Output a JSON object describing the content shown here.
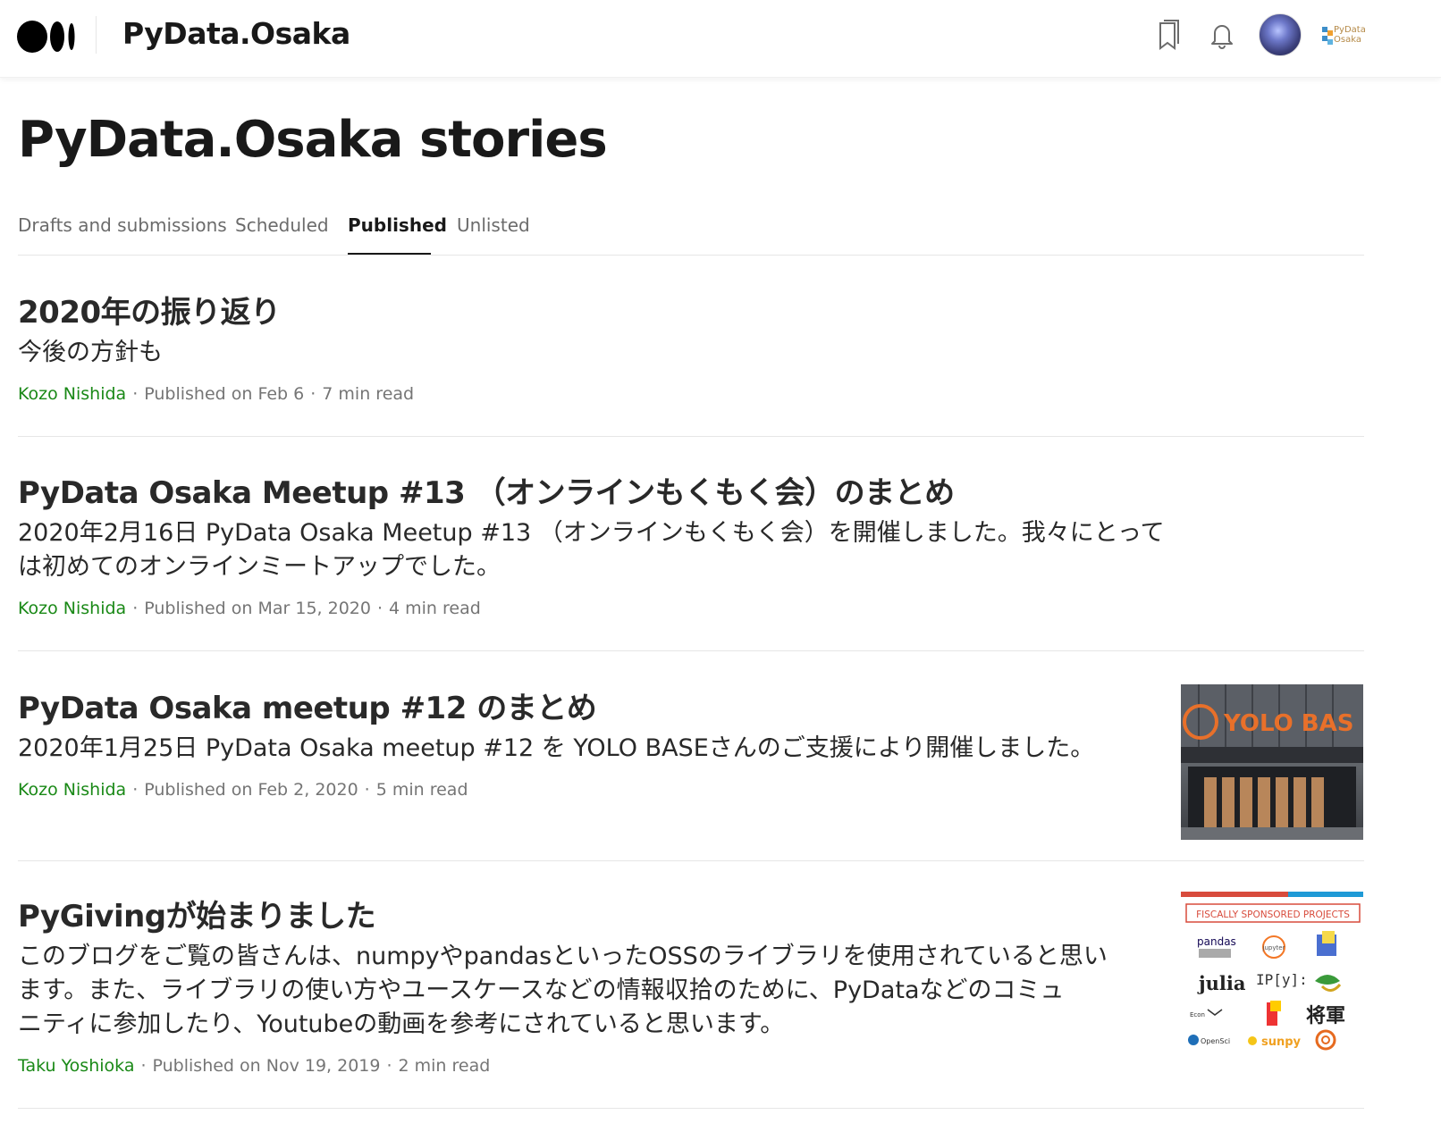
{
  "header": {
    "publication_name": "PyData.Osaka",
    "publication_logo_text": [
      "PyData",
      "Osaka"
    ],
    "icons": [
      "medium-logo-icon",
      "bookmark-icon",
      "bell-icon",
      "avatar",
      "publication-logo"
    ]
  },
  "page": {
    "title": "PyData.Osaka stories"
  },
  "tabs": [
    {
      "label": "Drafts and submissions",
      "active": false
    },
    {
      "label": "Scheduled",
      "active": false
    },
    {
      "label": "Published",
      "active": true
    },
    {
      "label": "Unlisted",
      "active": false
    }
  ],
  "stories": [
    {
      "title": "2020年の振り返り",
      "subtitle": "今後の方針も",
      "author": "Kozo Nishida",
      "published": "Published on Feb 6",
      "read_time": "7 min read"
    },
    {
      "title": "PyData Osaka Meetup #13 （オンラインもくもく会）のまとめ",
      "subtitle_lines": [
        "2020年2月16日 PyData Osaka Meetup #13 （オンラインもくもく会）を開催しました。我々にとって",
        "は初めてのオンラインミートアップでした。"
      ],
      "author": "Kozo Nishida",
      "published": "Published on Mar 15, 2020",
      "read_time": "4 min read"
    },
    {
      "title": "PyData Osaka meetup #12 のまとめ",
      "subtitle": "2020年1月25日 PyData Osaka meetup #12 を YOLO BASEさんのご支援により開催しました。",
      "author": "Kozo Nishida",
      "published": "Published on Feb 2, 2020",
      "read_time": "5 min read",
      "thumbnail_text": "YOLO BAS"
    },
    {
      "title": "PyGivingが始まりました",
      "subtitle_lines": [
        "このブログをご覧の皆さんは、numpyやpandasといったOSSのライブラリを使用されていると思い",
        "ます。また、ライブラリの使い方やユースケースなどの情報収拾のために、PyDataなどのコミュ",
        "ニティに参加したり、Youtubeの動画を参考にされていると思います。"
      ],
      "author": "Taku Yoshioka",
      "published": "Published on Nov 19, 2019",
      "read_time": "2 min read",
      "thumbnail_text": {
        "banner": "FISCALLY SPONSORED PROJECTS",
        "logos": [
          "pandas",
          "jupyter",
          "julia",
          "IP[y]:",
          "将軍",
          "sunpy",
          "OpenSci"
        ]
      }
    }
  ],
  "colors": {
    "author_green": "#1a8917",
    "meta_gray": "#757575",
    "tab_gray": "#6b6b6b",
    "text_dark": "#292929"
  }
}
